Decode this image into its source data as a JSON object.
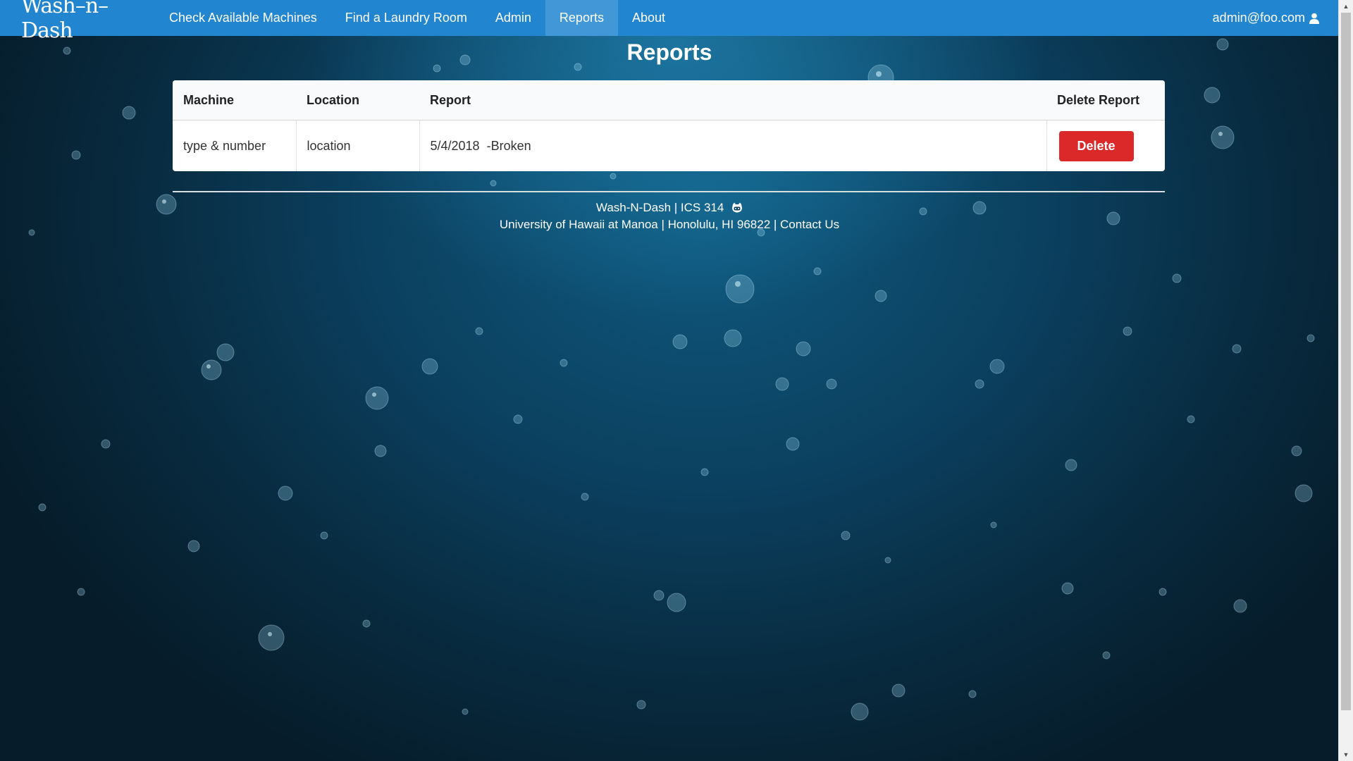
{
  "navbar": {
    "brand": "Wash–n–Dash",
    "items": [
      {
        "label": "Check Available Machines",
        "active": false
      },
      {
        "label": "Find a Laundry Room",
        "active": false
      },
      {
        "label": "Admin",
        "active": false
      },
      {
        "label": "Reports",
        "active": true
      },
      {
        "label": "About",
        "active": false
      }
    ],
    "user": "admin@foo.com",
    "user_icon": "user-icon",
    "color": "#2185d0"
  },
  "page": {
    "title": "Reports"
  },
  "table": {
    "headers": [
      "Machine",
      "Location",
      "Report",
      "Delete Report"
    ],
    "rows": [
      {
        "machine": "type & number",
        "location": "location",
        "report": "5/4/2018  -Broken",
        "action": "Delete"
      }
    ],
    "delete_color": "#db2828"
  },
  "footer": {
    "line1": "Wash-N-Dash | ICS 314",
    "line1_icon": "github-icon",
    "line2": "University of Hawaii at Manoa | Honolulu, HI 96822 |",
    "contact": "Contact Us"
  }
}
